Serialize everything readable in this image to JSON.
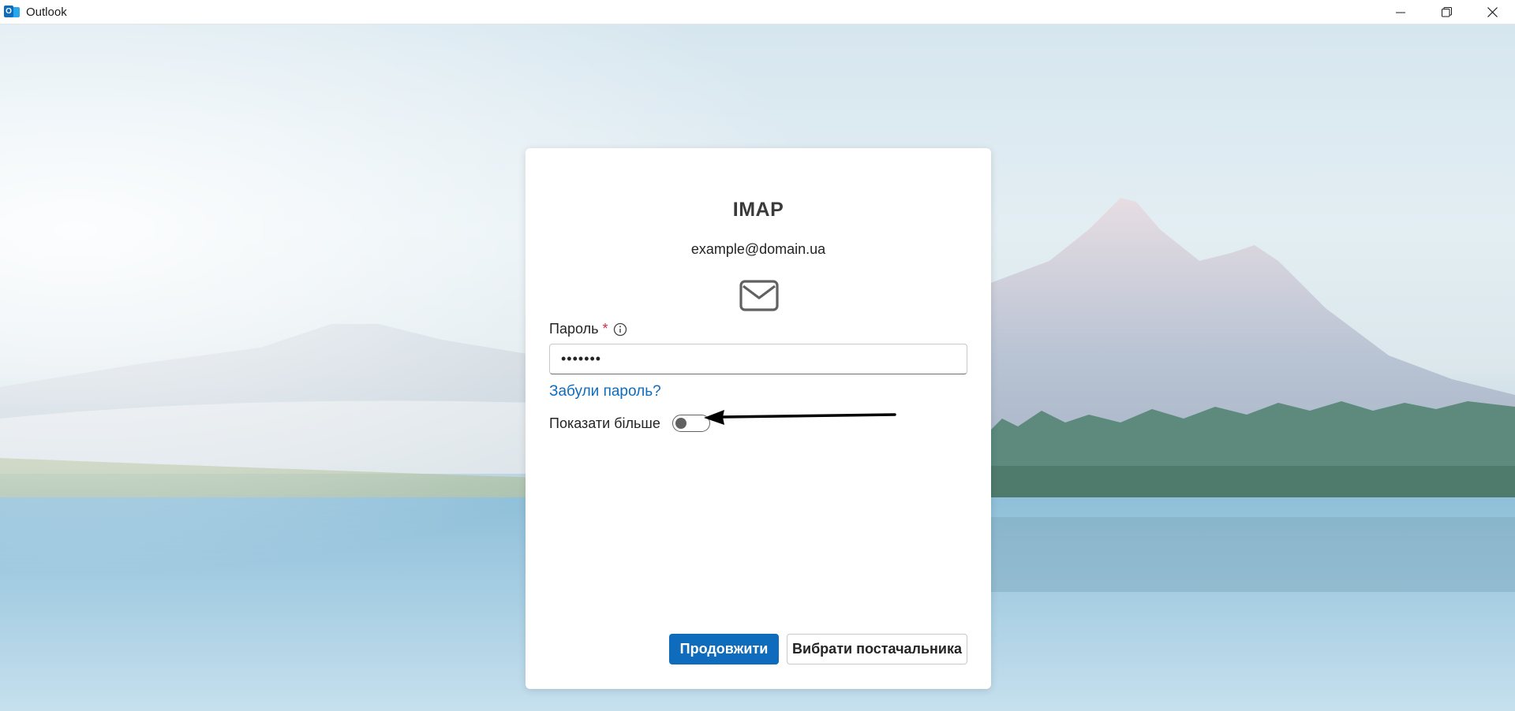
{
  "window": {
    "app_icon": "outlook-icon",
    "title": "Outlook",
    "controls": [
      "minimize-icon",
      "restore-icon",
      "close-icon"
    ]
  },
  "dialog": {
    "title": "IMAP",
    "email": "example@domain.ua",
    "mail_icon": "envelope-icon",
    "password_label": "Пароль",
    "required_mark": "*",
    "password_value": "•••••••",
    "forgot_link": "Забули пароль?",
    "show_more_label": "Показати більше",
    "show_more_toggle": "off",
    "continue_button": "Продовжити",
    "choose_provider_button": "Вибрати постачальника"
  },
  "colors": {
    "accent": "#0f6cbd",
    "required": "#c4314b",
    "annotation_arrow": "#000000"
  }
}
